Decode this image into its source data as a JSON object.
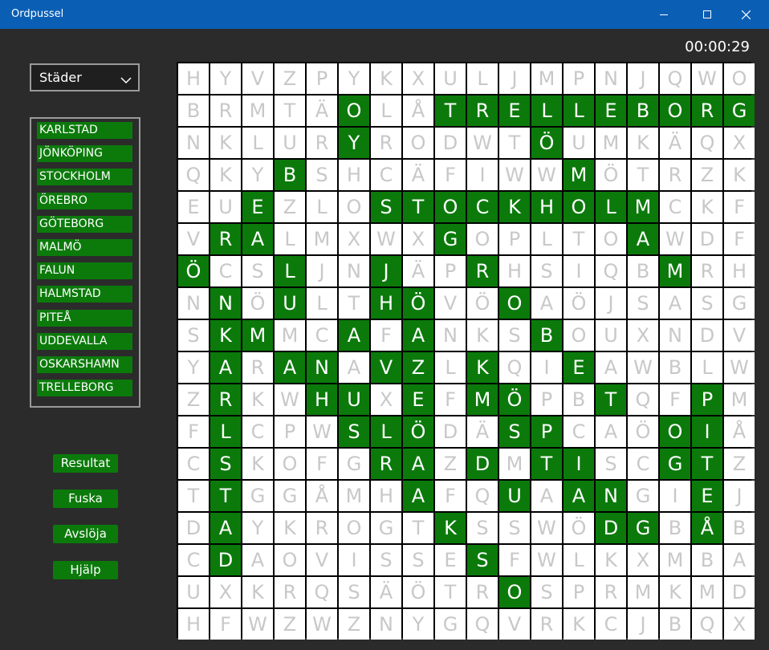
{
  "window": {
    "title": "Ordpussel",
    "minimize_icon": "minimize-icon",
    "maximize_icon": "maximize-icon",
    "close_icon": "close-icon"
  },
  "timer": "00:00:29",
  "category": {
    "selected": "Städer",
    "icon": "chevron-down-icon"
  },
  "words": [
    "KARLSTAD",
    "JÖNKÖPING",
    "STOCKHOLM",
    "ÖREBRO",
    "GÖTEBORG",
    "MALMÖ",
    "FALUN",
    "HALMSTAD",
    "PITEÅ",
    "UDDEVALLA",
    "OSKARSHAMN",
    "TRELLEBORG"
  ],
  "buttons": {
    "resultat": "Resultat",
    "fuska": "Fuska",
    "avsloja": "Avslöja",
    "hjalp": "Hjälp"
  },
  "colors": {
    "highlight": "#0b7a0b",
    "titlebar": "#0a5fb5",
    "background": "#2b2b2b"
  },
  "grid": {
    "rows": [
      "HYVZPYKXULJMPNJQWO",
      "BRMTÄOLÅTRELLEBORG",
      "NKLURYRODWTÖUMKÄQX",
      "QKYBSHCÄFIWWMÖTRZK",
      "EUEZLOSTOCKHOLMCKF",
      "VRALMXWXGOPLTOAWDF",
      "ÖCSLJNJÄPRHSIQBMRH",
      "NNÖULTHÖVÖOAÖJSASG",
      "SKMMCAFANKSBOUXNDV",
      "YARANAVZLKQIEAWBLW",
      "ZRKWHUXEFMÖPBTQFPM",
      "FLCPWSLÖDÄSPCAÖOIÅ",
      "CSKOFGRAZDMTISCGTZ",
      "TTGGÅMHAFQUAANGIEJ",
      "DAYKROGTKSSWÖDGBÅB",
      "CDAOVISSESFWLKXMBA",
      "UXKRQSÄÖTROSPRMKMD",
      "HFWZWZNYGQVRKCJBQX"
    ],
    "highlighted": [
      "000000000000000000",
      "000001001111111111",
      "000001000001000000",
      "000100000000100000",
      "001000111111111000",
      "011000001000001000",
      "100100100100000100",
      "010100110010000000",
      "011001010001000000",
      "010110110100100000",
      "010011010110010010",
      "010001110011000110",
      "010000110101100110",
      "010000010010110010",
      "010000001000011010",
      "010000000100000000",
      "000000000010000000",
      "000000000000000000"
    ]
  }
}
